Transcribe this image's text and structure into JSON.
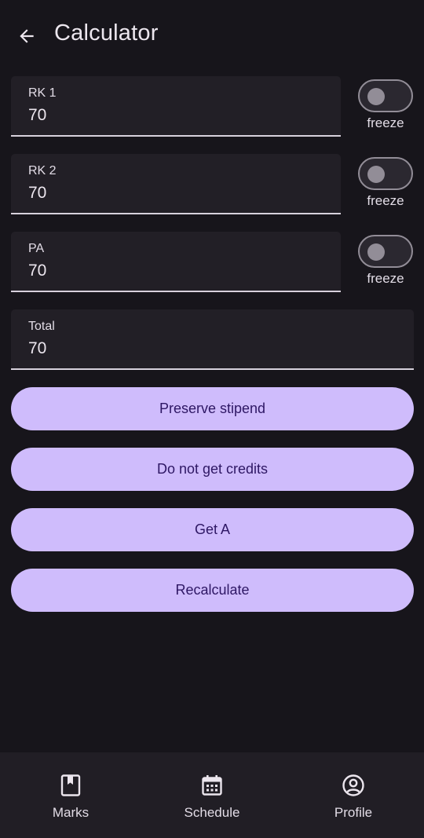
{
  "appbar": {
    "title": "Calculator",
    "back_icon": "arrow-back-icon"
  },
  "fields": [
    {
      "label": "RK 1",
      "value": "70",
      "freeze_label": "freeze",
      "freeze_on": false
    },
    {
      "label": "RK 2",
      "value": "70",
      "freeze_label": "freeze",
      "freeze_on": false
    },
    {
      "label": "PA",
      "value": "70",
      "freeze_label": "freeze",
      "freeze_on": false
    }
  ],
  "total": {
    "label": "Total",
    "value": "70"
  },
  "buttons": {
    "preserve_stipend": "Preserve stipend",
    "no_credits": "Do not get credits",
    "get_a": "Get A",
    "recalculate": "Recalculate"
  },
  "bottom_nav": [
    {
      "label": "Marks",
      "icon": "bookmark-book-icon"
    },
    {
      "label": "Schedule",
      "icon": "calendar-icon"
    },
    {
      "label": "Profile",
      "icon": "account-circle-icon"
    }
  ],
  "colors": {
    "background": "#17151b",
    "field_bg": "#221f26",
    "button_bg": "#cfbcfc",
    "button_text": "#2e1764",
    "nav_bg": "#211e25"
  }
}
